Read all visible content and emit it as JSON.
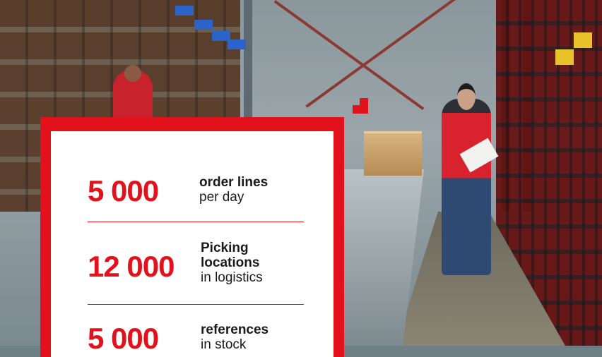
{
  "stats": [
    {
      "number": "5 000",
      "title": "order lines",
      "subtitle": "per day"
    },
    {
      "number": "12 000",
      "title_line1": "Picking",
      "title_line2": "locations",
      "subtitle": "in logistics"
    },
    {
      "number": "5 000",
      "title": "references",
      "subtitle": "in stock"
    }
  ],
  "colors": {
    "accent": "#e2121c",
    "card": "#ffffff"
  }
}
